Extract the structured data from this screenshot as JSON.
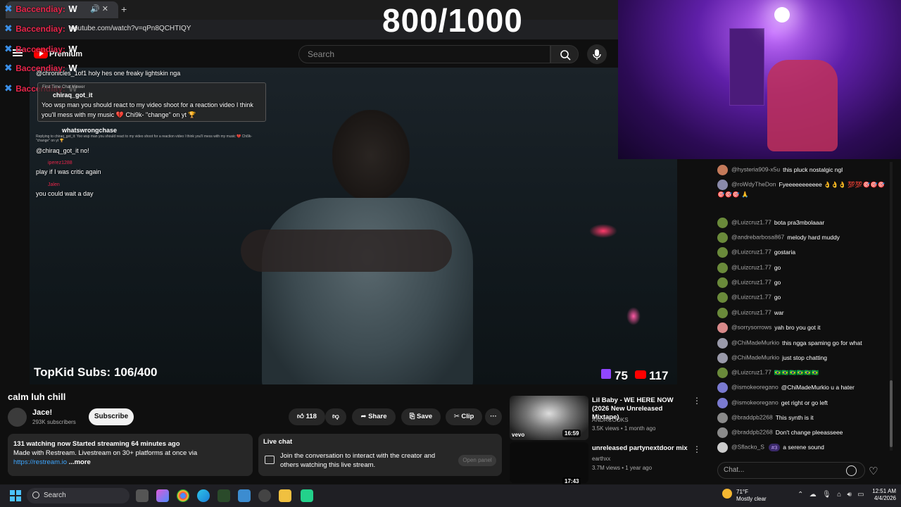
{
  "browser": {
    "tab_title": "Baccendiay:",
    "url": "youtube.com/watch?v=qPn8QCHTIQY",
    "new_tab": "+"
  },
  "header": {
    "logo_text": "Premium",
    "search_placeholder": "Search"
  },
  "overlay": {
    "counter": "800/1000",
    "subs_goal": "TopKid Subs: 106/400",
    "twitch_viewers": "75",
    "youtube_viewers": "117",
    "stream_chat_lines": [
      {
        "user": "Baccendiay:",
        "msg": "W"
      },
      {
        "user": "Baccendiay:",
        "msg": "W"
      },
      {
        "user": "Baccendiay:",
        "msg": "W"
      },
      {
        "user": "Baccendiay:",
        "msg": "W"
      },
      {
        "user": "Baccendiay:",
        "msg": "W"
      }
    ],
    "chat_messages": [
      {
        "text": "@chronicles_1of1 holy hes one freaky lightskin nga"
      },
      {
        "badge": "First Time Chat Viewer",
        "user": "chiraq_got_it",
        "text": "Yoo wsp man you should react to my video shoot for a reaction video I think you'll mess with my music 💔 Chi9k- \"change\" on yt 🏆"
      },
      {
        "user": "whatswrongchase",
        "reply": "Replying to chiraq_got_it: Yoo wsp man you should react to my video shoot for a reaction video I think you'll mess with my music 💔 Chi9k- \"change\" on yt 🏆",
        "text": "@chiraq_got_it no!"
      },
      {
        "user": "iperez1288",
        "text": "play if I was critic again"
      },
      {
        "user": "Jalen",
        "text": "you could wait a day"
      }
    ]
  },
  "video": {
    "title": "calm luh chill",
    "channel": "Jace!",
    "subscribers": "293K subscribers",
    "subscribe_label": "Subscribe",
    "likes": "118",
    "share_label": "Share",
    "save_label": "Save",
    "clip_label": "Clip",
    "more_label": "···",
    "description_stats": "131 watching now  Started streaming 64 minutes ago",
    "description_text": "Made with Restream. Livestream on 30+ platforms at once via",
    "description_link": "https://restream.io",
    "description_more": "...more"
  },
  "live_chat_box": {
    "title": "Live chat",
    "text": "Join the conversation to interact with the creator and others watching this live stream.",
    "button": "Open panel"
  },
  "recommendations": [
    {
      "title": "Lil Baby - WE HERE NOW (2026 New Unreleased Mixtape)",
      "channel": "ANDRCOOKS",
      "meta": "3.5K views • 1 month ago",
      "duration": "16:59",
      "badge": "vevo"
    },
    {
      "title": "unreleased partynextdoor mix",
      "channel": "earthxx",
      "meta": "3.7M views • 1 year ago",
      "duration": "17:43"
    }
  ],
  "live_chat": {
    "input_placeholder": "Chat...",
    "messages": [
      {
        "author": "@hysteria909-x5u",
        "text": "this pluck nostalgic ngl",
        "color": "#c47a5a"
      },
      {
        "author": "@roWdyTheDon",
        "text": "Fyeeeeeeeeeee 👌👌👌 💯💯🎯🎯🎯🎯🎯🎯 🙏",
        "color": "#8a8aaa"
      },
      {
        "author": "@Luizcruz1.77",
        "text": "bota pra3mbolaaar",
        "color": "#6a8a3a"
      },
      {
        "author": "@andrebarbosa867",
        "text": "melody hard muddy",
        "color": "#6a8a3a"
      },
      {
        "author": "@Luizcruz1.77",
        "text": "gostaria",
        "color": "#6a8a3a"
      },
      {
        "author": "@Luizcruz1.77",
        "text": "go",
        "color": "#6a8a3a"
      },
      {
        "author": "@Luizcruz1.77",
        "text": "go",
        "color": "#6a8a3a"
      },
      {
        "author": "@Luizcruz1.77",
        "text": "go",
        "color": "#6a8a3a"
      },
      {
        "author": "@Luizcruz1.77",
        "text": "war",
        "color": "#6a8a3a"
      },
      {
        "author": "@sorrysorrows",
        "text": "yah bro you got it",
        "color": "#d98a8a"
      },
      {
        "author": "@ChiMadeMurkio",
        "text": "this ngga spaming go for what",
        "color": "#9a9aaa"
      },
      {
        "author": "@ChiMadeMurkio",
        "text": "just stop chatting",
        "color": "#9a9aaa"
      },
      {
        "author": "@Luizcruz1.77",
        "text": "🇧🇷🇧🇷🇧🇷🇧🇷🇧🇷🇧🇷",
        "color": "#6a8a3a"
      },
      {
        "author": "@ismokeoregano",
        "text": "@ChiMadeMurkio u a hater",
        "color": "#7a7ad0"
      },
      {
        "author": "@ismokeoregano",
        "text": "get right or go left",
        "color": "#7a7ad0"
      },
      {
        "author": "@braddpb2268",
        "text": "This synth is it",
        "color": "#8a8a8a"
      },
      {
        "author": "@braddpb2268",
        "text": "Don't change pleeasseee",
        "color": "#8a8a8a"
      },
      {
        "author": "@Sflacko_S",
        "badge": "#3",
        "text": "a serene sound",
        "color": "#cccccc"
      }
    ]
  },
  "taskbar": {
    "search_label": "Search",
    "weather_temp": "71°F",
    "weather_desc": "Mostly clear",
    "time": "12:51 AM",
    "date": "4/4/2026"
  }
}
